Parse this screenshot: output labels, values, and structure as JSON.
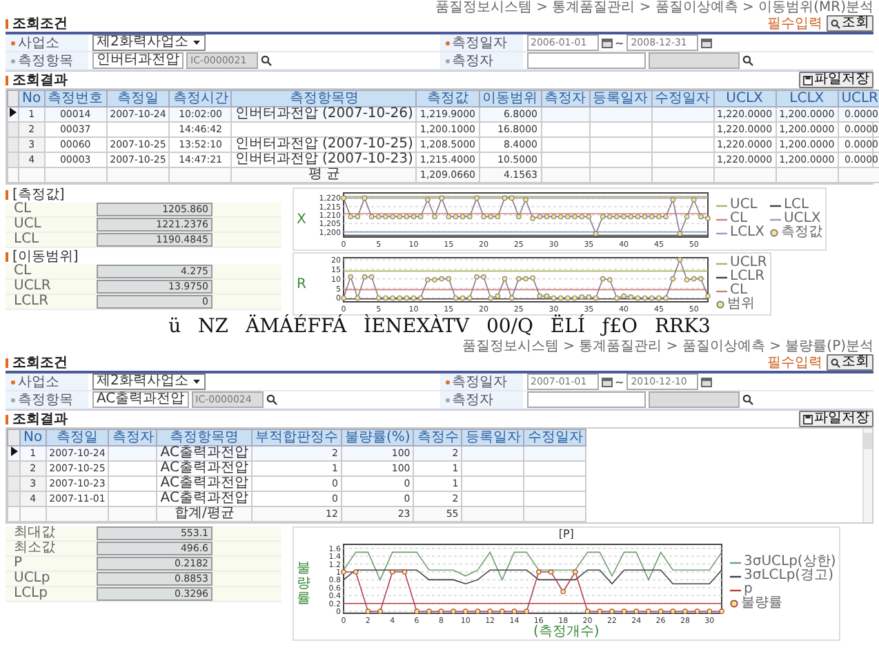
{
  "screens": [
    {
      "breadcrumb": "품질정보시스템 > 통계품질관리 > 품질이상예측 > 이동범위(MR)분석",
      "search": {
        "title": "조회조건",
        "required_note": "필수입력",
        "button": "조회",
        "fields": [
          {
            "label": "사업소",
            "required": true,
            "kind": "select",
            "value": "제2화력사업소"
          },
          {
            "label": "측정일자",
            "required": true,
            "kind": "date_range",
            "from": "2006-01-01",
            "separator": "~",
            "to": "2008-12-31"
          },
          {
            "label": "측정항목",
            "required": false,
            "kind": "code",
            "value": "인버터과전압",
            "code": "IC-0000021"
          },
          {
            "label": "측정자",
            "required": false,
            "kind": "pair"
          }
        ]
      },
      "results": {
        "title": "조회결과",
        "button": "파일저장",
        "columns": [
          {
            "label": "No",
            "kind": "index"
          },
          {
            "label": "측정번호",
            "kind": "code"
          },
          {
            "label": "측정일",
            "kind": "date"
          },
          {
            "label": "측정시간",
            "kind": "date"
          },
          {
            "label": "측정항목명",
            "kind": "text"
          },
          {
            "label": "측정값",
            "kind": "number"
          },
          {
            "label": "이동범위",
            "kind": "number"
          },
          {
            "label": "측정자",
            "kind": "code"
          },
          {
            "label": "등록일자",
            "kind": "date"
          },
          {
            "label": "수정일자",
            "kind": "date"
          },
          {
            "label": "UCLX",
            "kind": "number"
          },
          {
            "label": "LCLX",
            "kind": "number"
          },
          {
            "label": "UCLR",
            "kind": "number"
          }
        ],
        "rows": [
          {
            "selected": true,
            "cells": [
              "1",
              "00014",
              "2007-10-24",
              "10:02:00",
              "인버터과전압 (2007-10-26)",
              "1,219.9000",
              "6.8000",
              null,
              null,
              null,
              "1,220.0000",
              "1,200.0000",
              "0.0000"
            ]
          },
          {
            "selected": false,
            "cells": [
              "2",
              "00037",
              null,
              "14:46:42",
              null,
              "1,200.1000",
              "16.8000",
              null,
              null,
              null,
              "1,220.0000",
              "1,200.0000",
              "0.0000"
            ]
          },
          {
            "selected": false,
            "cells": [
              "3",
              "00060",
              "2007-10-25",
              "13:52:10",
              "인버터과전압 (2007-10-25)",
              "1,208.5000",
              "8.4000",
              null,
              null,
              null,
              "1,220.0000",
              "1,200.0000",
              "0.0000"
            ]
          },
          {
            "selected": false,
            "cells": [
              "4",
              "00003",
              "2007-10-25",
              "14:47:21",
              "인버터과전압 (2007-10-23)",
              "1,215.4000",
              "10.5000",
              null,
              null,
              null,
              "1,220.0000",
              "1,200.0000",
              "0.0000"
            ]
          }
        ],
        "total": {
          "cells": [
            null,
            null,
            null,
            null,
            "평 균",
            "1,209.0660",
            "4.1563",
            null,
            null,
            null,
            null,
            null,
            null
          ]
        }
      },
      "stats": [
        {
          "title": "[측정값]",
          "items": [
            {
              "label": "CL",
              "value": "1205.860"
            },
            {
              "label": "UCL",
              "value": "1221.2376"
            },
            {
              "label": "LCL",
              "value": "1190.4845"
            }
          ]
        },
        {
          "title": "[이동범위]",
          "items": [
            {
              "label": "CL",
              "value": "4.275"
            },
            {
              "label": "UCLR",
              "value": "13.9750"
            },
            {
              "label": "LCLR",
              "value": "0"
            }
          ]
        }
      ],
      "charts": [
        {
          "chart_data": {
            "type": "line",
            "ylabel": "X",
            "grid": true,
            "xlim": [
              0,
              52
            ],
            "ylim": [
              1197,
              1223
            ],
            "x": [
              0,
              1,
              2,
              3,
              4,
              5,
              6,
              7,
              8,
              9,
              10,
              11,
              12,
              13,
              14,
              15,
              16,
              17,
              18,
              19,
              20,
              21,
              22,
              23,
              24,
              25,
              26,
              27,
              28,
              29,
              30,
              31,
              32,
              33,
              34,
              35,
              36,
              37,
              38,
              39,
              40,
              41,
              42,
              43,
              44,
              45,
              46,
              47,
              48,
              49,
              50,
              51,
              52
            ],
            "xticks": [
              0,
              5,
              10,
              15,
              20,
              25,
              30,
              35,
              40,
              45,
              50
            ],
            "yticks": [
              {
                "value": 1200,
                "label": "1,200"
              },
              {
                "value": 1205,
                "label": "1,205"
              },
              {
                "value": 1210,
                "label": "1,210"
              },
              {
                "value": 1215,
                "label": "1,215"
              },
              {
                "value": 1220,
                "label": "1,220"
              }
            ],
            "series": [
              {
                "name": "UCL",
                "color": "#b0b060",
                "marker": false,
                "values": [
                  1221,
                  1221,
                  1221,
                  1221,
                  1221,
                  1221,
                  1221,
                  1221,
                  1221,
                  1221,
                  1221,
                  1221,
                  1221,
                  1221,
                  1221,
                  1221,
                  1221,
                  1221,
                  1221,
                  1221,
                  1221,
                  1221,
                  1221,
                  1221,
                  1221,
                  1221,
                  1221,
                  1221,
                  1221,
                  1221,
                  1221,
                  1221,
                  1221,
                  1221,
                  1221,
                  1221,
                  1221,
                  1221,
                  1221,
                  1221,
                  1221,
                  1221,
                  1221,
                  1221,
                  1221,
                  1221,
                  1221,
                  1221,
                  1221,
                  1221,
                  1221,
                  1221,
                  1221
                ]
              },
              {
                "name": "LCL",
                "color": "#404040",
                "marker": false,
                "values": [
                  1198,
                  1198,
                  1198,
                  1198,
                  1198,
                  1198,
                  1198,
                  1198,
                  1198,
                  1198,
                  1198,
                  1198,
                  1198,
                  1198,
                  1198,
                  1198,
                  1198,
                  1198,
                  1198,
                  1198,
                  1198,
                  1198,
                  1198,
                  1198,
                  1198,
                  1198,
                  1198,
                  1198,
                  1198,
                  1198,
                  1198,
                  1198,
                  1198,
                  1198,
                  1198,
                  1198,
                  1198,
                  1198,
                  1198,
                  1198,
                  1198,
                  1198,
                  1198,
                  1198,
                  1198,
                  1198,
                  1198,
                  1198,
                  1198,
                  1198,
                  1198,
                  1198,
                  1198
                ]
              },
              {
                "name": "CL",
                "color": "#d08080",
                "marker": false,
                "values": [
                  1210.8,
                  1210.8,
                  1210.8,
                  1210.8,
                  1210.8,
                  1210.8,
                  1210.8,
                  1210.8,
                  1210.8,
                  1210.8,
                  1210.8,
                  1210.8,
                  1210.8,
                  1210.8,
                  1210.8,
                  1210.8,
                  1210.8,
                  1210.8,
                  1210.8,
                  1210.8,
                  1210.8,
                  1210.8,
                  1210.8,
                  1210.8,
                  1210.8,
                  1210.8,
                  1210.8,
                  1210.8,
                  1210.8,
                  1210.8,
                  1210.8,
                  1210.8,
                  1210.8,
                  1210.8,
                  1210.8,
                  1210.8,
                  1210.8,
                  1210.8,
                  1210.8,
                  1210.8,
                  1210.8,
                  1210.8,
                  1210.8,
                  1210.8,
                  1210.8,
                  1210.8,
                  1210.8,
                  1210.8,
                  1210.8,
                  1210.8,
                  1210.8,
                  1210.8,
                  1210.8
                ]
              },
              {
                "name": "UCLX",
                "color": "#9a9ab4",
                "marker": false,
                "values": [
                  1220,
                  1220,
                  1220,
                  1220,
                  1220,
                  1220,
                  1220,
                  1220,
                  1220,
                  1220,
                  1220,
                  1220,
                  1220,
                  1220,
                  1220,
                  1220,
                  1220,
                  1220,
                  1220,
                  1220,
                  1220,
                  1220,
                  1220,
                  1220,
                  1220,
                  1220,
                  1220,
                  1220,
                  1220,
                  1220,
                  1220,
                  1220,
                  1220,
                  1220,
                  1220,
                  1220,
                  1220,
                  1220,
                  1220,
                  1220,
                  1220,
                  1220,
                  1220,
                  1220,
                  1220,
                  1220,
                  1220,
                  1220,
                  1220,
                  1220,
                  1220,
                  1220,
                  1220
                ]
              },
              {
                "name": "LCLX",
                "color": "#8fa0c8",
                "marker": false,
                "values": [
                  1200,
                  1200,
                  1200,
                  1200,
                  1200,
                  1200,
                  1200,
                  1200,
                  1200,
                  1200,
                  1200,
                  1200,
                  1200,
                  1200,
                  1200,
                  1200,
                  1200,
                  1200,
                  1200,
                  1200,
                  1200,
                  1200,
                  1200,
                  1200,
                  1200,
                  1200,
                  1200,
                  1200,
                  1200,
                  1200,
                  1200,
                  1200,
                  1200,
                  1200,
                  1200,
                  1200,
                  1200,
                  1200,
                  1200,
                  1200,
                  1200,
                  1200,
                  1200,
                  1200,
                  1200,
                  1200,
                  1200,
                  1200,
                  1200,
                  1200,
                  1200,
                  1200,
                  1200
                ]
              },
              {
                "name": "측정값",
                "color": "#8a7a8a",
                "marker": true,
                "values": [
                  1220,
                  1209,
                  1209,
                  1220,
                  1209,
                  1209,
                  1209,
                  1209,
                  1209,
                  1209,
                  1209,
                  1209,
                  1219,
                  1209,
                  1220,
                  1209,
                  1209,
                  1209,
                  1209,
                  1220,
                  1209,
                  1209,
                  1209,
                  1220,
                  1220,
                  1209,
                  1219,
                  1208,
                  1209,
                  1209,
                  1209,
                  1209,
                  1209,
                  1209,
                  1209,
                  1209,
                  1199,
                  1209,
                  1209,
                  1209,
                  1209,
                  1209,
                  1209,
                  1209,
                  1209,
                  1209,
                  1209,
                  1219,
                  1199,
                  1209,
                  1219,
                  1209,
                  1208
                ]
              }
            ]
          }
        },
        {
          "chart_data": {
            "type": "line",
            "ylabel": "R",
            "grid": true,
            "xlim": [
              0,
              52
            ],
            "ylim": [
              -2,
              21
            ],
            "x": [
              0,
              1,
              2,
              3,
              4,
              5,
              6,
              7,
              8,
              9,
              10,
              11,
              12,
              13,
              14,
              15,
              16,
              17,
              18,
              19,
              20,
              21,
              22,
              23,
              24,
              25,
              26,
              27,
              28,
              29,
              30,
              31,
              32,
              33,
              34,
              35,
              36,
              37,
              38,
              39,
              40,
              41,
              42,
              43,
              44,
              45,
              46,
              47,
              48,
              49,
              50,
              51,
              52
            ],
            "xticks": [
              0,
              5,
              10,
              15,
              20,
              25,
              30,
              35,
              40,
              45,
              50
            ],
            "yticks": [
              0,
              5,
              10,
              15,
              20
            ],
            "series": [
              {
                "name": "UCLR",
                "color": "#b0b060",
                "marker": false,
                "values": [
                  14,
                  14,
                  14,
                  14,
                  14,
                  14,
                  14,
                  14,
                  14,
                  14,
                  14,
                  14,
                  14,
                  14,
                  14,
                  14,
                  14,
                  14,
                  14,
                  14,
                  14,
                  14,
                  14,
                  14,
                  14,
                  14,
                  14,
                  14,
                  14,
                  14,
                  14,
                  14,
                  14,
                  14,
                  14,
                  14,
                  14,
                  14,
                  14,
                  14,
                  14,
                  14,
                  14,
                  14,
                  14,
                  14,
                  14,
                  14,
                  14,
                  14,
                  14,
                  14,
                  14
                ]
              },
              {
                "name": "LCLR",
                "color": "#404040",
                "marker": false,
                "values": [
                  -0.5,
                  -0.5,
                  -0.5,
                  -0.5,
                  -0.5,
                  -0.5,
                  -0.5,
                  -0.5,
                  -0.5,
                  -0.5,
                  -0.5,
                  -0.5,
                  -0.5,
                  -0.5,
                  -0.5,
                  -0.5,
                  -0.5,
                  -0.5,
                  -0.5,
                  -0.5,
                  -0.5,
                  -0.5,
                  -0.5,
                  -0.5,
                  -0.5,
                  -0.5,
                  -0.5,
                  -0.5,
                  -0.5,
                  -0.5,
                  -0.5,
                  -0.5,
                  -0.5,
                  -0.5,
                  -0.5,
                  -0.5,
                  -0.5,
                  -0.5,
                  -0.5,
                  -0.5,
                  -0.5,
                  -0.5,
                  -0.5,
                  -0.5,
                  -0.5,
                  -0.5,
                  -0.5,
                  -0.5,
                  -0.5,
                  -0.5,
                  -0.5,
                  -0.5,
                  -0.5
                ]
              },
              {
                "name": "CL",
                "color": "#d08080",
                "marker": false,
                "values": [
                  4.3,
                  4.3,
                  4.3,
                  4.3,
                  4.3,
                  4.3,
                  4.3,
                  4.3,
                  4.3,
                  4.3,
                  4.3,
                  4.3,
                  4.3,
                  4.3,
                  4.3,
                  4.3,
                  4.3,
                  4.3,
                  4.3,
                  4.3,
                  4.3,
                  4.3,
                  4.3,
                  4.3,
                  4.3,
                  4.3,
                  4.3,
                  4.3,
                  4.3,
                  4.3,
                  4.3,
                  4.3,
                  4.3,
                  4.3,
                  4.3,
                  4.3,
                  4.3,
                  4.3,
                  4.3,
                  4.3,
                  4.3,
                  4.3,
                  4.3,
                  4.3,
                  4.3,
                  4.3,
                  4.3,
                  4.3,
                  4.3,
                  4.3,
                  4.3,
                  4.3,
                  4.3
                ]
              },
              {
                "name": "범위",
                "color": "#8a7a8a",
                "marker": true,
                "values": [
                  0,
                  11,
                  0,
                  11,
                  11,
                  0,
                  0,
                  0,
                  0,
                  0,
                  0,
                  0,
                  9.5,
                  9.5,
                  10,
                  10,
                  0,
                  0,
                  0,
                  11,
                  11,
                  0,
                  1,
                  10,
                  0,
                  10,
                  10,
                  10.5,
                  1,
                  1,
                  0,
                  0,
                  0,
                  0,
                  0.5,
                  0.5,
                  0,
                  10,
                  9.5,
                  0,
                  1,
                  0.5,
                  0,
                  0,
                  0,
                  0,
                  0,
                  10,
                  20,
                  9.5,
                  10,
                  10,
                  1
                ]
              }
            ]
          }
        }
      ]
    },
    {
      "breadcrumb": "품질정보시스템 > 통계품질관리 > 품질이상예측 > 불량률(P)분석",
      "search": {
        "title": "조회조건",
        "required_note": "필수입력",
        "button": "조회",
        "fields": [
          {
            "label": "사업소",
            "required": true,
            "kind": "select",
            "value": "제2화력사업소"
          },
          {
            "label": "측정일자",
            "required": true,
            "kind": "date_range",
            "from": "2007-01-01",
            "separator": "~",
            "to": "2010-12-10"
          },
          {
            "label": "측정항목",
            "required": false,
            "kind": "code",
            "value": "AC출력과전압",
            "code": "IC-0000024"
          },
          {
            "label": "측정자",
            "required": false,
            "kind": "pair"
          }
        ]
      },
      "results": {
        "title": "조회결과",
        "button": "파일저장",
        "columns": [
          {
            "label": "No",
            "kind": "index"
          },
          {
            "label": "측정일",
            "kind": "date"
          },
          {
            "label": "측정자",
            "kind": "code"
          },
          {
            "label": "측정항목명",
            "kind": "text"
          },
          {
            "label": "부적합판정수",
            "kind": "number"
          },
          {
            "label": "불량률(%)",
            "kind": "number"
          },
          {
            "label": "측정수",
            "kind": "number"
          },
          {
            "label": "등록일자",
            "kind": "date"
          },
          {
            "label": "수정일자",
            "kind": "date"
          }
        ],
        "rows": [
          {
            "selected": true,
            "cells": [
              "1",
              "2007-10-24",
              null,
              "AC출력과전압",
              "2",
              "100",
              "2",
              null,
              null
            ]
          },
          {
            "selected": false,
            "cells": [
              "2",
              "2007-10-25",
              null,
              "AC출력과전압",
              "1",
              "100",
              "1",
              null,
              null
            ]
          },
          {
            "selected": false,
            "cells": [
              "3",
              "2007-10-23",
              null,
              "AC출력과전압",
              "0",
              "0",
              "1",
              null,
              null
            ]
          },
          {
            "selected": false,
            "cells": [
              "4",
              "2007-11-01",
              null,
              "AC출력과전압",
              "0",
              "0",
              "2",
              null,
              null
            ]
          }
        ],
        "total": {
          "cells": [
            null,
            null,
            null,
            "합계/평균",
            "12",
            "23",
            "55",
            null,
            null
          ]
        }
      },
      "stats": [
        {
          "items": [
            {
              "label": "최대값",
              "value": "553.1"
            },
            {
              "label": "최소값",
              "value": "496.6"
            },
            {
              "label": "P",
              "value": "0.2182"
            },
            {
              "label": "UCLp",
              "value": "0.8853"
            },
            {
              "label": "LCLp",
              "value": "0.3296"
            }
          ]
        }
      ],
      "charts": [
        {
          "chart_data": {
            "type": "line",
            "title": "[P]",
            "xlabel": "(측정개수)",
            "ylabel": "불량률",
            "grid": true,
            "xlim": [
              0,
              31
            ],
            "ylim": [
              -0.05,
              1.7
            ],
            "x": [
              0,
              1,
              2,
              3,
              4,
              5,
              6,
              7,
              8,
              9,
              10,
              11,
              12,
              13,
              14,
              15,
              16,
              17,
              18,
              19,
              20,
              21,
              22,
              23,
              24,
              25,
              26,
              27,
              28,
              29,
              30,
              31
            ],
            "xticks": [
              0,
              2,
              4,
              6,
              8,
              10,
              12,
              14,
              16,
              18,
              20,
              22,
              24,
              26,
              28,
              30
            ],
            "yticks": [
              0,
              0.2,
              0.4,
              0.6,
              0.8,
              1,
              1.2,
              1.4,
              1.6
            ],
            "series": [
              {
                "name": "3σUCLp(상한)",
                "color": "#70a070",
                "marker": false,
                "values": [
                  1.05,
                  1.5,
                  1.5,
                  0.8,
                  1.5,
                  1.5,
                  1.5,
                  1.05,
                  1.05,
                  1.05,
                  0.9,
                  1.05,
                  1.5,
                  0.8,
                  1.5,
                  1.5,
                  1.05,
                  1.05,
                  1.05,
                  1.05,
                  1.5,
                  1.5,
                  0.9,
                  1.5,
                  1.5,
                  0.8,
                  1.5,
                  1.05,
                  1.05,
                  1.05,
                  1.05,
                  1.5
                ]
              },
              {
                "name": "3σLCLp(경고)",
                "color": "#404040",
                "marker": false,
                "values": [
                  0.8,
                  1.05,
                  1.05,
                  1.05,
                  1.05,
                  1.05,
                  1.05,
                  0.8,
                  0.8,
                  0.8,
                  0.7,
                  0.8,
                  1.05,
                  1.05,
                  1.05,
                  1.05,
                  0.8,
                  0.8,
                  0.8,
                  0.8,
                  1.05,
                  1.05,
                  0.7,
                  1.05,
                  1.05,
                  1.05,
                  1.05,
                  0.7,
                  0.7,
                  0.7,
                  0.7,
                  1.05
                ]
              },
              {
                "name": "p",
                "color": "#c04040",
                "marker": false,
                "values": [
                  0.2,
                  0.2,
                  0.2,
                  0.2,
                  0.2,
                  0.2,
                  0.2,
                  0.2,
                  0.2,
                  0.2,
                  0.2,
                  0.2,
                  0.2,
                  0.2,
                  0.2,
                  0.2,
                  0.2,
                  0.2,
                  0.2,
                  0.2,
                  0.2,
                  0.2,
                  0.2,
                  0.2,
                  0.2,
                  0.2,
                  0.2,
                  0.2,
                  0.2,
                  0.2,
                  0.2,
                  0.2
                ]
              },
              {
                "name": "불량률",
                "color": "#b04050",
                "marker": true,
                "values": [
                  1,
                  1,
                  0,
                  0,
                  1,
                  1,
                  0,
                  0,
                  0,
                  0,
                  0,
                  0,
                  0,
                  0,
                  0,
                  0,
                  1,
                  1,
                  0.5,
                  1,
                  0,
                  0,
                  0,
                  0,
                  0,
                  0,
                  0,
                  0,
                  0,
                  0,
                  0,
                  0
                ]
              }
            ]
          }
        }
      ]
    }
  ],
  "caption": "ü NZ ÄMÁÉFFÁ ÌENEXÀTV 00/Q ËLÍ ƒ£O RRK3"
}
